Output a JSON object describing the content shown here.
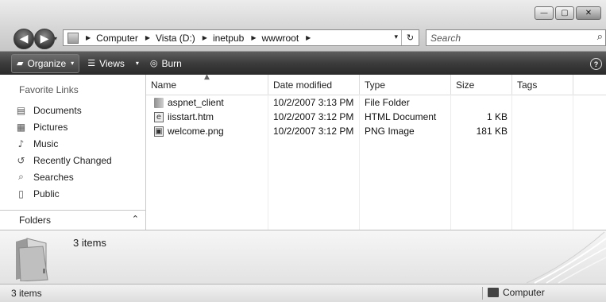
{
  "window": {
    "minimize_glyph": "—",
    "maximize_glyph": "▢",
    "close_glyph": "✕"
  },
  "navigation": {
    "back_glyph": "◀",
    "forward_glyph": "▶",
    "history_dropdown_glyph": "▾"
  },
  "address_bar": {
    "breadcrumbs": [
      "Computer",
      "Vista (D:)",
      "inetpub",
      "wwwroot"
    ],
    "separator_glyph": "▶",
    "dropdown_glyph": "▾",
    "refresh_glyph": "↻"
  },
  "search": {
    "placeholder": "Search",
    "icon_glyph": "⌕"
  },
  "command_bar": {
    "organize_label": "Organize",
    "views_label": "Views",
    "burn_label": "Burn",
    "dropdown_glyph": "▾",
    "help_glyph": "?"
  },
  "nav_pane": {
    "heading": "Favorite Links",
    "items": [
      {
        "label": "Documents",
        "icon": "documents-icon",
        "glyph": "▤"
      },
      {
        "label": "Pictures",
        "icon": "pictures-icon",
        "glyph": "▦"
      },
      {
        "label": "Music",
        "icon": "music-icon",
        "glyph": "♪"
      },
      {
        "label": "Recently Changed",
        "icon": "recently-changed-icon",
        "glyph": "↺"
      },
      {
        "label": "Searches",
        "icon": "searches-icon",
        "glyph": "⌕"
      },
      {
        "label": "Public",
        "icon": "public-icon",
        "glyph": "▯"
      }
    ],
    "folders_label": "Folders",
    "folders_chevron": "⌃"
  },
  "file_list": {
    "columns": [
      "Name",
      "Date modified",
      "Type",
      "Size",
      "Tags"
    ],
    "sort_glyph": "▲",
    "rows": [
      {
        "name": "aspnet_client",
        "date": "10/2/2007 3:13 PM",
        "type": "File Folder",
        "size": "",
        "icon": "folder-icon",
        "glyph": ""
      },
      {
        "name": "iisstart.htm",
        "date": "10/2/2007 3:12 PM",
        "type": "HTML Document",
        "size": "1 KB",
        "icon": "html-file-icon",
        "glyph": "e"
      },
      {
        "name": "welcome.png",
        "date": "10/2/2007 3:12 PM",
        "type": "PNG Image",
        "size": "181 KB",
        "icon": "png-file-icon",
        "glyph": "▣"
      }
    ]
  },
  "details_pane": {
    "count_text": "3 items"
  },
  "status_bar": {
    "count_text": "3 items",
    "location_text": "Computer"
  },
  "colors": {
    "command_bar": "#3c3c3c",
    "title_band": "#d6d6d6",
    "details_pane": "#ececec"
  }
}
